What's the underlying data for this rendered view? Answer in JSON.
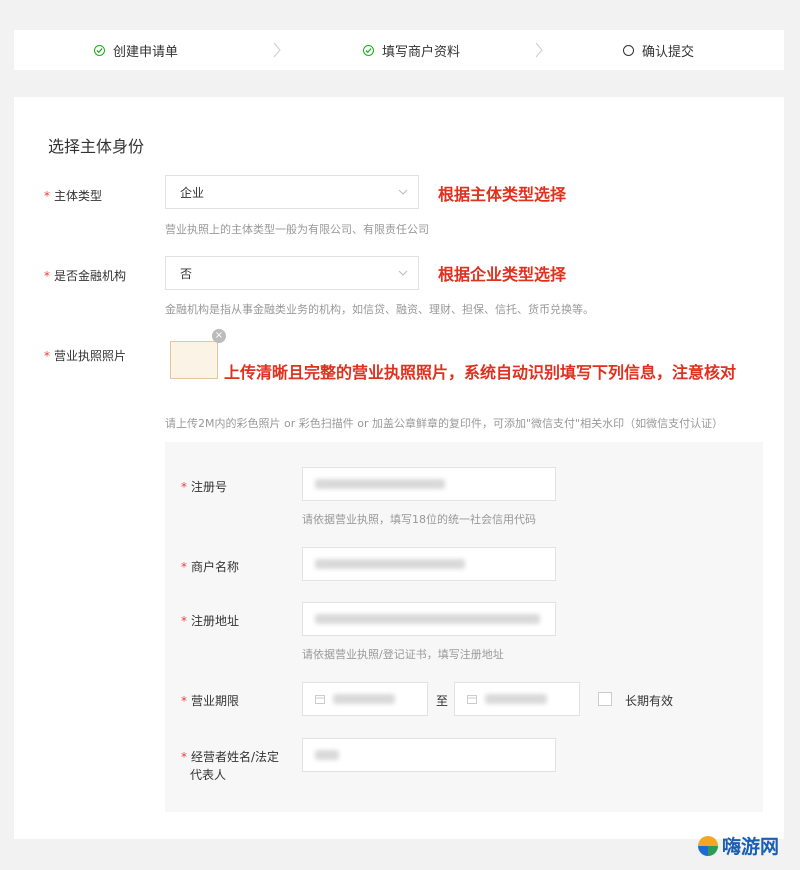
{
  "steps": [
    {
      "label": "创建申请单",
      "state": "done"
    },
    {
      "label": "填写商户资料",
      "state": "done"
    },
    {
      "label": "确认提交",
      "state": "pending"
    }
  ],
  "form": {
    "section_title": "选择主体身份",
    "subject_type": {
      "label": "主体类型",
      "value": "企业",
      "hint": "营业执照上的主体类型一般为有限公司、有限责任公司",
      "annotation": "根据主体类型选择"
    },
    "financial": {
      "label": "是否金融机构",
      "value": "否",
      "hint": "金融机构是指从事金融类业务的机构，如信贷、融资、理财、担保、信托、货币兑换等。",
      "annotation": "根据企业类型选择"
    },
    "license_photo": {
      "label": "营业执照照片",
      "annotation": "上传清晰且完整的营业执照照片，系统自动识别填写下列信息，注意核对",
      "hint": "请上传2M内的彩色照片 or 彩色扫描件 or 加盖公章鲜章的复印件，可添加\"微信支付\"相关水印（如微信支付认证）"
    },
    "reg_no": {
      "label": "注册号",
      "hint": "请依据营业执照，填写18位的统一社会信用代码"
    },
    "merchant_name": {
      "label": "商户名称"
    },
    "reg_address": {
      "label": "注册地址",
      "hint": "请依据营业执照/登记证书，填写注册地址"
    },
    "period": {
      "label": "营业期限",
      "separator": "至",
      "long_term": "长期有效"
    },
    "legal_rep": {
      "label_line1": "经营者姓名/法定",
      "label_line2": "代表人"
    }
  },
  "watermark": {
    "text": "嗨游网"
  },
  "colors": {
    "accent_green": "#1aad19",
    "annotation_red": "#e0301e",
    "required_red": "#e64340"
  },
  "icons": {
    "done": "check-circle-icon",
    "pending": "circle-icon",
    "separator": "chevron-right-icon",
    "dropdown": "chevron-down-icon",
    "calendar": "calendar-icon"
  }
}
